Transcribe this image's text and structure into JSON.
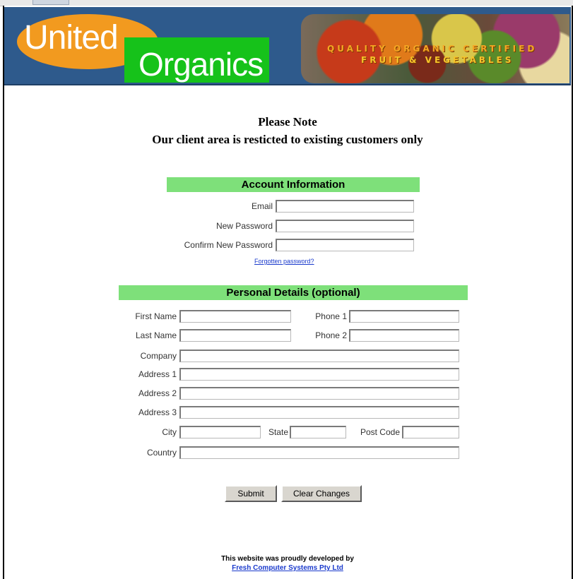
{
  "banner": {
    "logo_united": "United",
    "logo_organics": "Organics",
    "tagline_1": "QUALITY ORGANIC CERTIFIED",
    "tagline_2": "FRUIT & VEGETABLES",
    "colors": {
      "banner_bg": "#2e5a8c",
      "logo_orange": "#f29a1f",
      "logo_green": "#16c21a"
    }
  },
  "notice": {
    "line1": "Please Note",
    "line2": "Our client area is resticted to existing customers only"
  },
  "account": {
    "header": "Account Information",
    "email_label": "Email",
    "email_value": "",
    "new_password_label": "New Password",
    "new_password_value": "",
    "confirm_password_label": "Confirm New Password",
    "confirm_password_value": "",
    "forgot_link": "Forgotten password?"
  },
  "personal": {
    "header": "Personal Details (optional)",
    "first_name_label": "First Name",
    "last_name_label": "Last Name",
    "phone1_label": "Phone 1",
    "phone2_label": "Phone 2",
    "company_label": "Company",
    "address1_label": "Address 1",
    "address2_label": "Address 2",
    "address3_label": "Address 3",
    "city_label": "City",
    "state_label": "State",
    "postcode_label": "Post Code",
    "country_label": "Country"
  },
  "actions": {
    "submit_label": "Submit",
    "clear_label": "Clear Changes"
  },
  "footer": {
    "line1": "This website was proudly developed by",
    "link": "Fresh Computer Systems Pty Ltd"
  },
  "colors": {
    "section_header": "#7ee07a",
    "link": "#1a3acc"
  }
}
